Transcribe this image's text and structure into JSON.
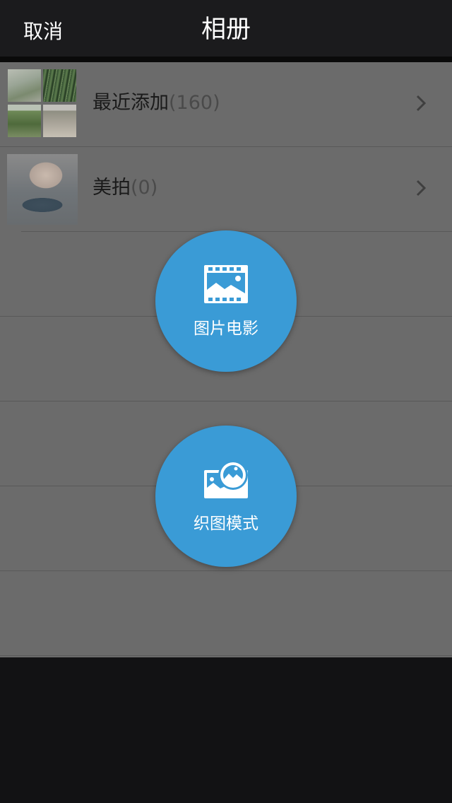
{
  "navbar": {
    "cancel_label": "取消",
    "title": "相册"
  },
  "albums": [
    {
      "name": "最近添加",
      "count": "(160)"
    },
    {
      "name": "美拍",
      "count": "(0)"
    }
  ],
  "actions": [
    {
      "label": "图片电影",
      "icon": "film-image-icon"
    },
    {
      "label": "织图模式",
      "icon": "picture-collage-icon"
    }
  ],
  "colors": {
    "accent": "#3a9bd6",
    "navbar": "#1b1b1d",
    "overlay": "#6b6b6b"
  }
}
